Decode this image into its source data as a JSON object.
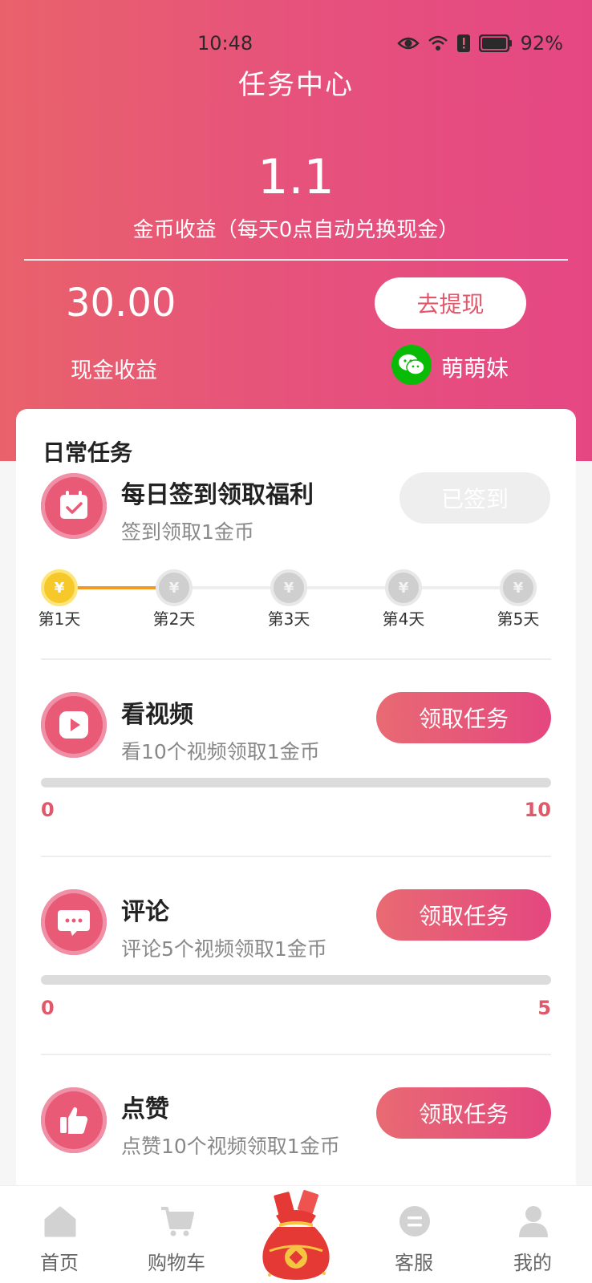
{
  "status_bar": {
    "time": "10:48",
    "battery": "92%"
  },
  "header": {
    "title": "任务中心"
  },
  "earnings": {
    "coin_value": "1.1",
    "coin_caption": "金币收益（每天0点自动兑换现金）",
    "cash_value": "30.00",
    "cash_label": "现金收益",
    "withdraw_label": "去提现",
    "wechat_name": "萌萌妹"
  },
  "daily": {
    "section_title": "日常任务",
    "checkin": {
      "title": "每日签到领取福利",
      "desc": "签到领取1金币",
      "button": "已签到",
      "days": [
        "第1天",
        "第2天",
        "第3天",
        "第4天",
        "第5天"
      ],
      "coin_symbol": "¥",
      "completed_days": 1
    },
    "tasks": [
      {
        "title": "看视频",
        "desc": "看10个视频领取1金币",
        "button": "领取任务",
        "progress_min": "0",
        "progress_max": "10",
        "progress": 0,
        "icon": "play-icon"
      },
      {
        "title": "评论",
        "desc": "评论5个视频领取1金币",
        "button": "领取任务",
        "progress_min": "0",
        "progress_max": "5",
        "progress": 0,
        "icon": "comment-icon"
      },
      {
        "title": "点赞",
        "desc": "点赞10个视频领取1金币",
        "button": "领取任务",
        "icon": "thumbs-up-icon"
      }
    ]
  },
  "tabbar": {
    "items": [
      {
        "label": "首页",
        "icon": "home-icon"
      },
      {
        "label": "购物车",
        "icon": "cart-icon"
      },
      {
        "label": "",
        "icon": "red-envelope-bag-icon"
      },
      {
        "label": "客服",
        "icon": "customer-service-icon"
      },
      {
        "label": "我的",
        "icon": "user-icon"
      }
    ]
  },
  "colors": {
    "accent": "#e54783",
    "header_start": "#e9626b",
    "coin_gold": "#f7c829",
    "wechat_green": "#09bb07"
  }
}
